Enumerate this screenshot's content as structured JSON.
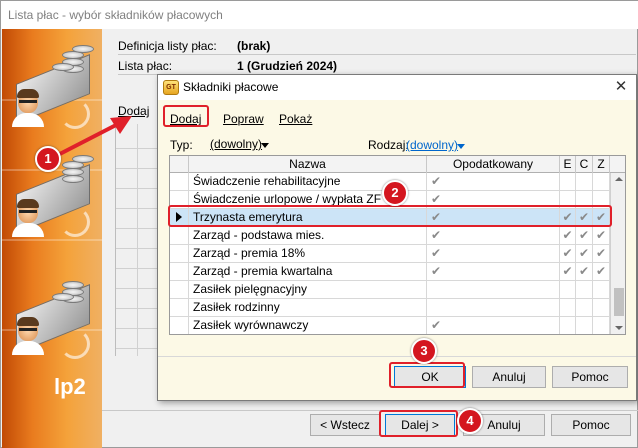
{
  "window": {
    "title": "Lista płac - wybór składników płacowych"
  },
  "sidebar": {
    "brand": "lp2"
  },
  "info": [
    {
      "label": "Definicja listy płac:",
      "value": "(brak)"
    },
    {
      "label": "Lista płac:",
      "value": "1 (Grudzień 2024)"
    }
  ],
  "background_link": "Dodaj",
  "wizard_buttons": {
    "back": "< Wstecz",
    "next": "Dalej >",
    "cancel": "Anuluj",
    "help": "Pomoc"
  },
  "dialog": {
    "icon_text": "GT",
    "title": "Składniki płacowe",
    "close": "✕",
    "links": {
      "add": "Dodaj",
      "edit": "Popraw",
      "show": "Pokaż"
    },
    "filters": {
      "type_label": "Typ:",
      "type_value": "(dowolny)",
      "kind_label": "Rodzaj:",
      "kind_value": "(dowolny)"
    },
    "table": {
      "columns": {
        "name": "Nazwa",
        "taxed": "Opodatkowany",
        "e": "E",
        "c": "C",
        "z": "Z"
      },
      "rows": [
        {
          "name": "Świadczenie rehabilitacyjne",
          "taxed": "✔",
          "e": "",
          "c": "",
          "z": ""
        },
        {
          "name": "Świadczenie urlopowe / wypłata ZF",
          "taxed": "✔",
          "e": "",
          "c": "",
          "z": ""
        },
        {
          "name": "Trzynasta emerytura",
          "taxed": "✔",
          "e": "✔",
          "c": "✔",
          "z": "✔"
        },
        {
          "name": "Zarząd - podstawa mies.",
          "taxed": "✔",
          "e": "✔",
          "c": "✔",
          "z": "✔"
        },
        {
          "name": "Zarząd - premia 18%",
          "taxed": "✔",
          "e": "✔",
          "c": "✔",
          "z": "✔"
        },
        {
          "name": "Zarząd - premia kwartalna",
          "taxed": "✔",
          "e": "✔",
          "c": "✔",
          "z": "✔"
        },
        {
          "name": "Zasiłek pielęgnacyjny",
          "taxed": "",
          "e": "",
          "c": "",
          "z": ""
        },
        {
          "name": "Zasiłek rodzinny",
          "taxed": "",
          "e": "",
          "c": "",
          "z": ""
        },
        {
          "name": "Zasiłek wyrównawczy",
          "taxed": "✔",
          "e": "",
          "c": "",
          "z": ""
        }
      ]
    },
    "buttons": {
      "ok": "OK",
      "cancel": "Anuluj",
      "help": "Pomoc"
    }
  },
  "annotations": [
    "1",
    "2",
    "3",
    "4"
  ],
  "colors": {
    "accent_orange": "#e97b1e",
    "annotation_red": "#e0202a",
    "selection": "#cce4f7",
    "dialog_bg": "#fcf9e6"
  }
}
